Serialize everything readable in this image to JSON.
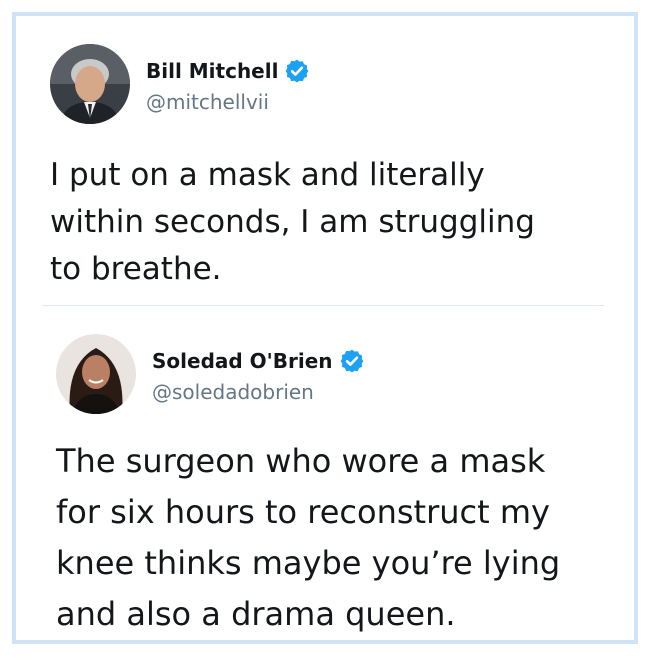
{
  "tweets": [
    {
      "display_name": "Bill Mitchell",
      "handle": "@mitchellvii",
      "verified": true,
      "avatar_icon": "avatar-photo-man-gray-hair",
      "lines": [
        "I put on a mask and literally",
        "within seconds, I am struggling",
        "to breathe."
      ]
    },
    {
      "display_name": "Soledad O'Brien",
      "handle": "@soledadobrien",
      "verified": true,
      "avatar_icon": "avatar-photo-woman-dark-hair",
      "lines": [
        "The surgeon who wore a mask",
        "for six hours to reconstruct my",
        "knee thinks maybe you’re lying",
        "and also a drama queen."
      ]
    }
  ],
  "colors": {
    "frame_border": "#cfe3f5",
    "verified_badge": "#1da1f2",
    "name_text": "#14171a",
    "handle_text": "#657786",
    "divider": "#e1e8ed"
  }
}
